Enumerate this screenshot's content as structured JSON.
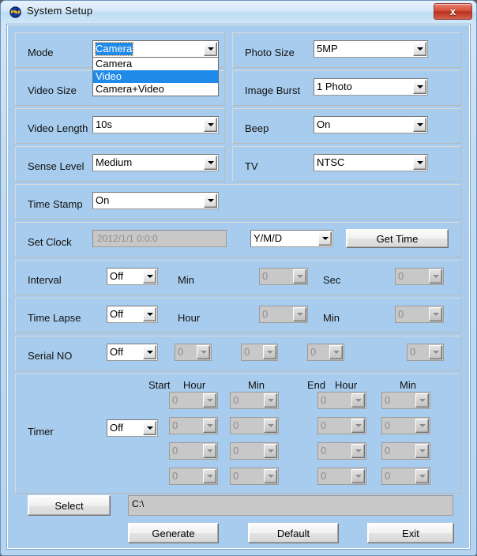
{
  "window": {
    "title": "System Setup",
    "icon": "globe-icon",
    "close_label": "x",
    "accent_blue": "#1f8ae8",
    "client_bg": "#a8cced"
  },
  "rows": {
    "mode": {
      "label": "Mode",
      "value": "Camera",
      "options": [
        "Camera",
        "Video",
        "Camera+Video"
      ],
      "highlighted_option": "Video",
      "open": true
    },
    "photo_size": {
      "label": "Photo Size",
      "value": "5MP"
    },
    "video_size": {
      "label": "Video Size",
      "value": ""
    },
    "image_burst": {
      "label": "Image Burst",
      "value": "1 Photo"
    },
    "video_length": {
      "label": "Video Length",
      "value": "10s"
    },
    "beep": {
      "label": "Beep",
      "value": "On"
    },
    "sense_level": {
      "label": "Sense Level",
      "value": "Medium"
    },
    "tv": {
      "label": "TV",
      "value": "NTSC"
    },
    "time_stamp": {
      "label": "Time Stamp",
      "value": "On"
    },
    "set_clock": {
      "label": "Set Clock",
      "datetime": "2012/1/1  0:0:0",
      "format": "Y/M/D",
      "get_time_label": "Get Time"
    },
    "interval": {
      "label": "Interval",
      "value": "Off",
      "min_label": "Min",
      "min_value": "0",
      "sec_label": "Sec",
      "sec_value": "0"
    },
    "time_lapse": {
      "label": "Time Lapse",
      "value": "Off",
      "hour_label": "Hour",
      "hour_value": "0",
      "min_label": "Min",
      "min_value": "0"
    },
    "serial_no": {
      "label": "Serial NO",
      "value": "Off",
      "digits": [
        "0",
        "0",
        "0",
        "0"
      ]
    },
    "timer": {
      "label": "Timer",
      "value": "Off",
      "start_label": "Start",
      "end_label": "End",
      "start_hour_label": "Hour",
      "start_min_label": "Min",
      "end_hour_label": "Hour",
      "end_min_label": "Min",
      "grid": [
        [
          "0",
          "0",
          "0",
          "0"
        ],
        [
          "0",
          "0",
          "0",
          "0"
        ],
        [
          "0",
          "0",
          "0",
          "0"
        ],
        [
          "0",
          "0",
          "0",
          "0"
        ]
      ]
    }
  },
  "footer": {
    "select_label": "Select",
    "path_value": "C:\\",
    "generate_label": "Generate",
    "default_label": "Default",
    "exit_label": "Exit"
  }
}
